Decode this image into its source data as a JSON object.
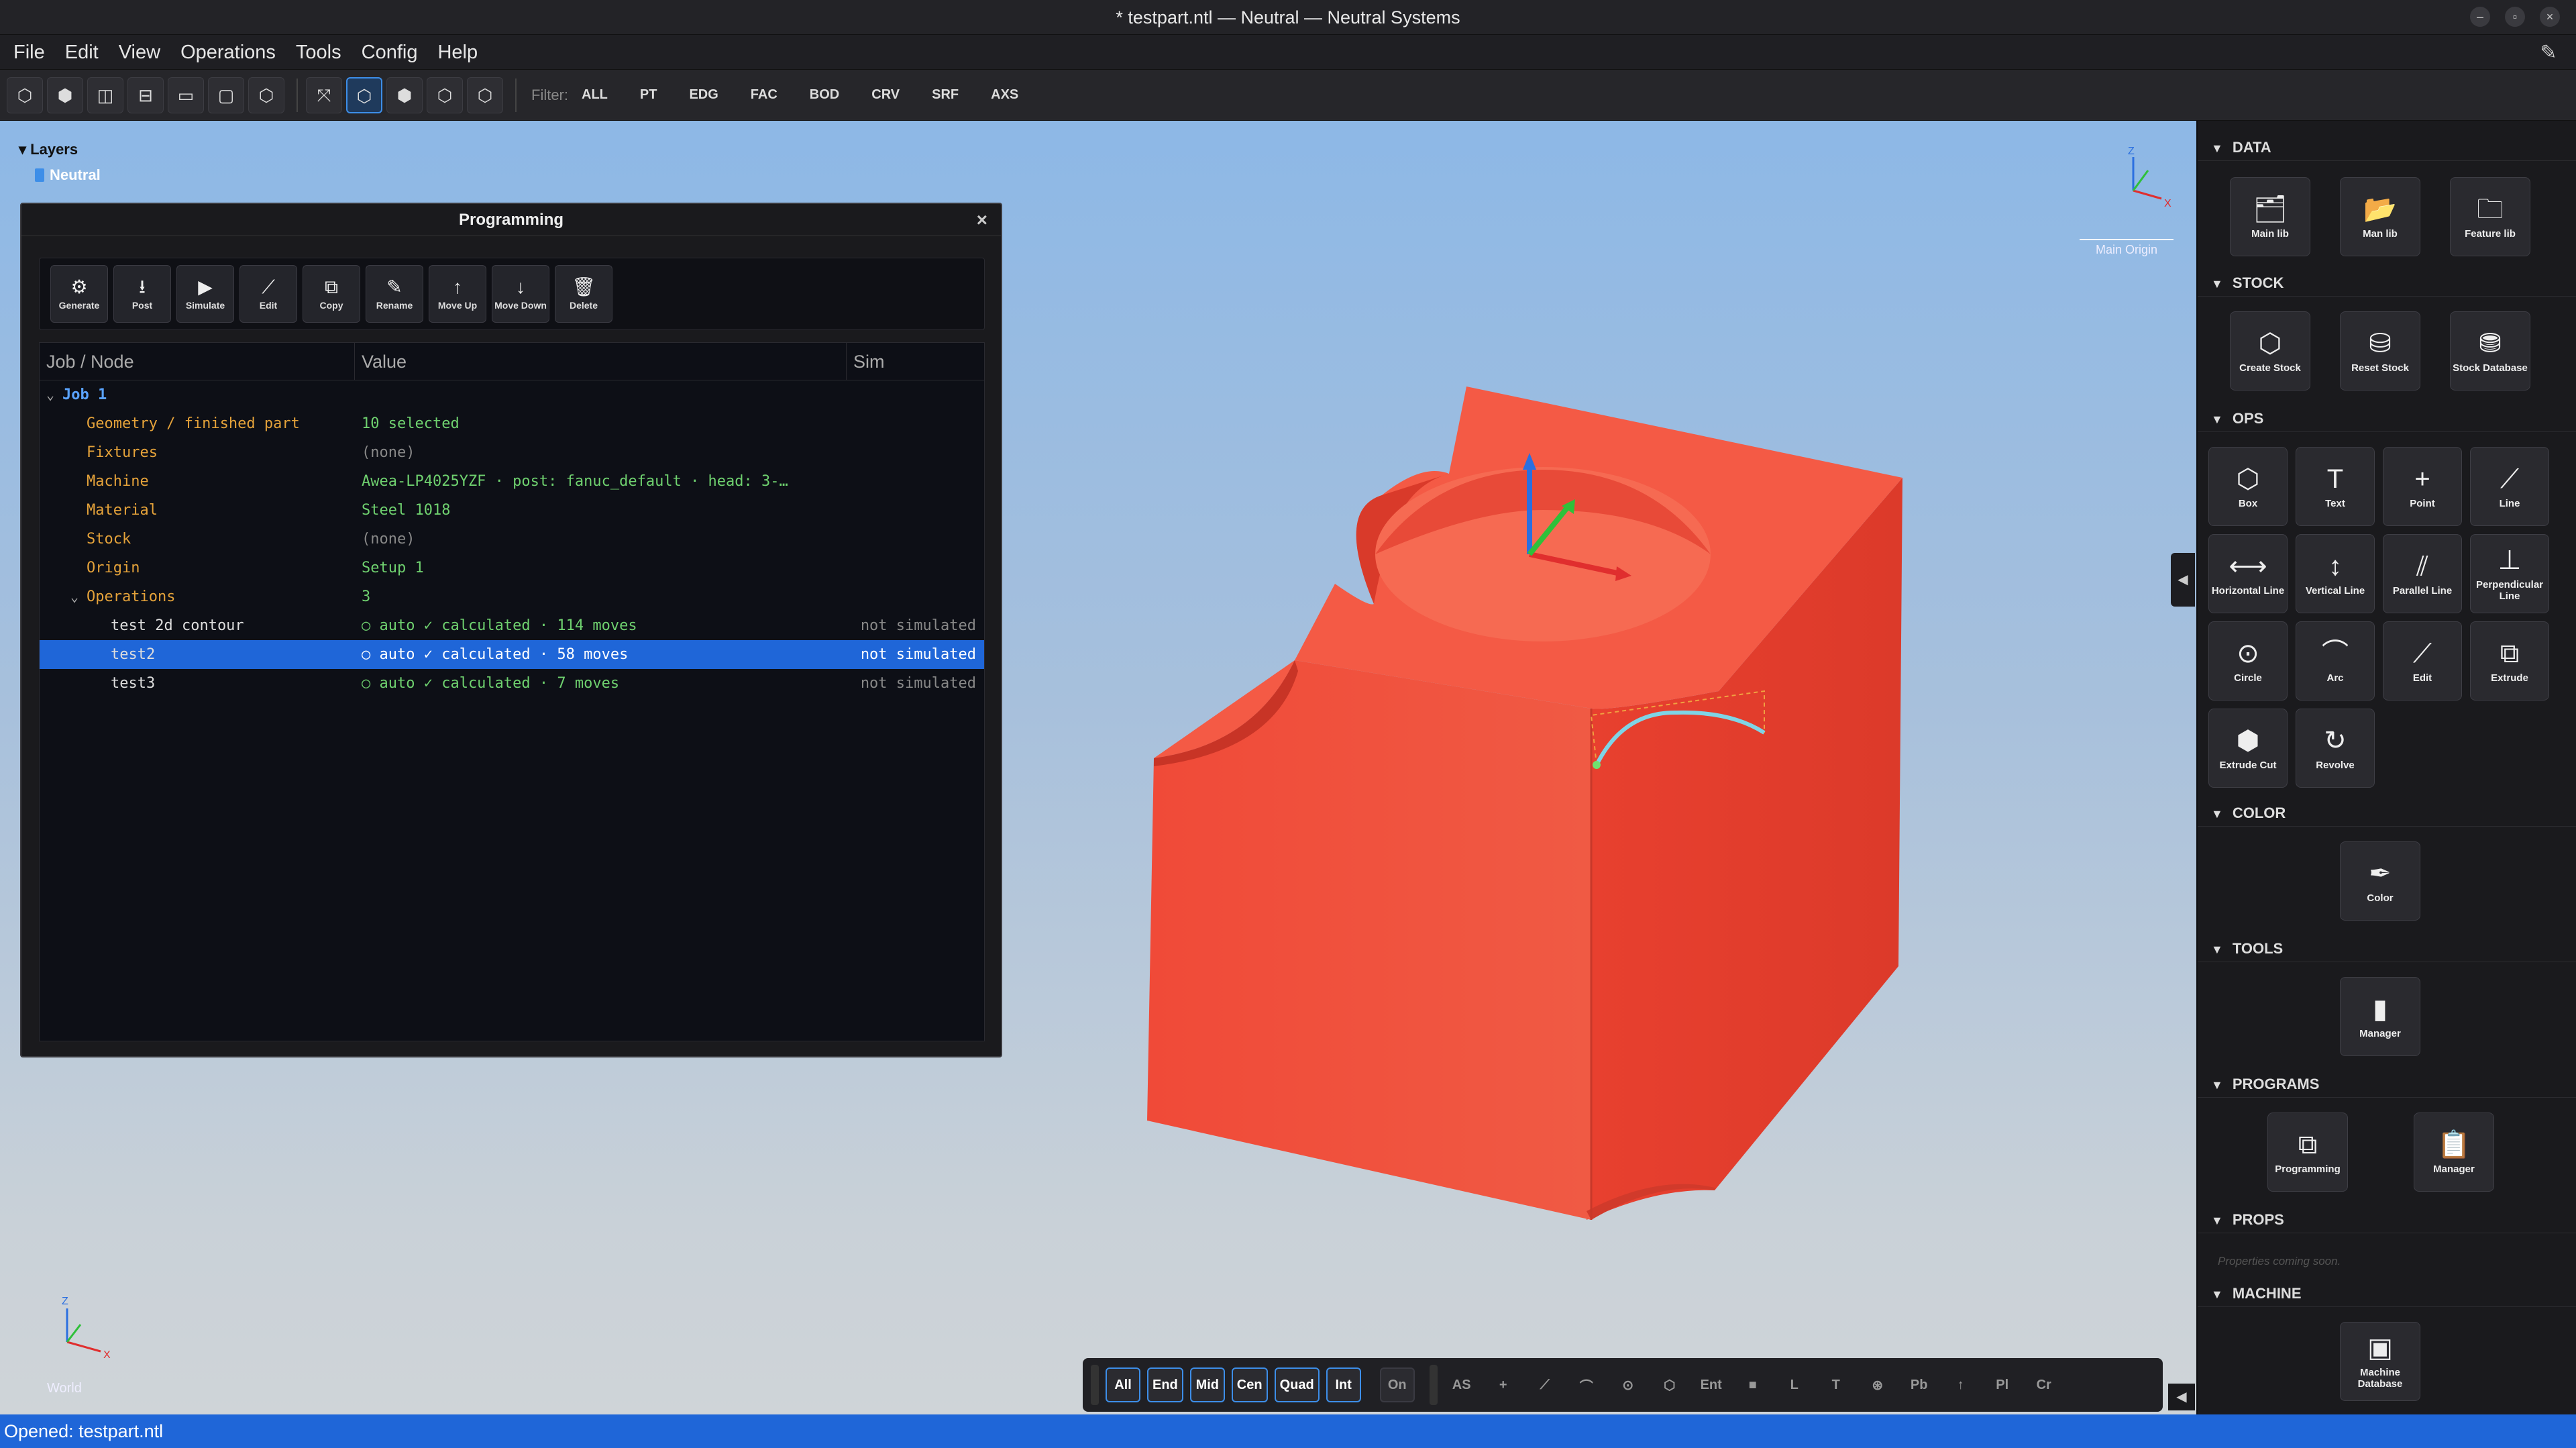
{
  "window": {
    "title": "* testpart.ntl — Neutral — Neutral Systems",
    "controls": [
      "–",
      "▫",
      "×"
    ]
  },
  "menubar": {
    "items": [
      "File",
      "Edit",
      "View",
      "Operations",
      "Tools",
      "Config",
      "Help"
    ]
  },
  "toolbar": {
    "view_icons": [
      "view-front-icon",
      "view-top-icon",
      "view-iso-icon",
      "view-left-icon",
      "view-back-icon",
      "view-bottom-icon",
      "view-right-icon",
      "fit-icon",
      "shaded-icon",
      "wire-icon",
      "hidden-icon",
      "edges-icon"
    ],
    "active_view_index": 8,
    "filter_label": "Filter:",
    "filters": [
      "ALL",
      "PT",
      "EDG",
      "FAC",
      "BOD",
      "CRV",
      "SRF",
      "AXS"
    ]
  },
  "layers": {
    "title": "Layers",
    "items": [
      "Neutral"
    ]
  },
  "viewport": {
    "main_origin": "Main Origin",
    "world": "World",
    "part_color": "#f0493a"
  },
  "programming": {
    "title": "Programming",
    "close": "×",
    "buttons": [
      {
        "icon": "gear-icon",
        "glyph": "⚙",
        "label": "Generate"
      },
      {
        "icon": "post-icon",
        "glyph": "⭳",
        "label": "Post"
      },
      {
        "icon": "play-icon",
        "glyph": "▶",
        "label": "Simulate"
      },
      {
        "icon": "edit-path-icon",
        "glyph": "⟋",
        "label": "Edit"
      },
      {
        "icon": "copy-icon",
        "glyph": "⧉",
        "label": "Copy"
      },
      {
        "icon": "rename-icon",
        "glyph": "✎",
        "label": "Rename"
      },
      {
        "icon": "arrow-up-icon",
        "glyph": "↑",
        "label": "Move Up"
      },
      {
        "icon": "arrow-down-icon",
        "glyph": "↓",
        "label": "Move Down"
      },
      {
        "icon": "trash-icon",
        "glyph": "🗑",
        "label": "Delete"
      }
    ],
    "columns": [
      "Job / Node",
      "Value",
      "Sim"
    ],
    "rows": [
      {
        "kind": "job",
        "indent": 0,
        "chev": "⌄",
        "node": "Job 1",
        "value": "",
        "sim": ""
      },
      {
        "kind": "prop",
        "indent": 1,
        "chev": "",
        "node": "Geometry / finished part",
        "value": "10 selected",
        "sim": ""
      },
      {
        "kind": "prop",
        "indent": 1,
        "chev": "",
        "node": "Fixtures",
        "value": "(none)",
        "sim": "",
        "none": true
      },
      {
        "kind": "prop",
        "indent": 1,
        "chev": "",
        "node": "Machine",
        "value": "Awea-LP4025YZF  ·  post: fanuc_default  ·  head: 3-…",
        "sim": ""
      },
      {
        "kind": "prop",
        "indent": 1,
        "chev": "",
        "node": "Material",
        "value": "Steel 1018",
        "sim": ""
      },
      {
        "kind": "prop",
        "indent": 1,
        "chev": "",
        "node": "Stock",
        "value": "(none)",
        "sim": "",
        "none": true
      },
      {
        "kind": "prop",
        "indent": 1,
        "chev": "",
        "node": "Origin",
        "value": "Setup 1",
        "sim": ""
      },
      {
        "kind": "prop",
        "indent": 1,
        "chev": "⌄",
        "node": "Operations",
        "value": "3",
        "sim": ""
      },
      {
        "kind": "op",
        "indent": 2,
        "chev": "",
        "node": "test 2d contour",
        "value": "○ auto   ✓ calculated · 114 moves",
        "sim": "not simulated"
      },
      {
        "kind": "op",
        "indent": 2,
        "chev": "",
        "node": "test2",
        "value": "○ auto   ✓ calculated · 58 moves",
        "sim": "not simulated",
        "selected": true
      },
      {
        "kind": "op",
        "indent": 2,
        "chev": "",
        "node": "test3",
        "value": "○ auto   ✓ calculated · 7 moves",
        "sim": "not simulated"
      }
    ]
  },
  "rightpanel": {
    "sections": [
      {
        "title": "DATA",
        "buttons": [
          {
            "icon": "main-lib-icon",
            "glyph": "🗂",
            "label": "Main lib"
          },
          {
            "icon": "man-lib-icon",
            "glyph": "📂",
            "label": "Man lib"
          },
          {
            "icon": "feature-lib-icon",
            "glyph": "🗀",
            "label": "Feature lib"
          }
        ]
      },
      {
        "title": "STOCK",
        "buttons": [
          {
            "icon": "create-stock-icon",
            "glyph": "⬡",
            "label": "Create Stock"
          },
          {
            "icon": "reset-stock-icon",
            "glyph": "⛁",
            "label": "Reset Stock"
          },
          {
            "icon": "stock-database-icon",
            "glyph": "⛃",
            "label": "Stock Database"
          }
        ]
      },
      {
        "title": "OPS",
        "buttons": [
          {
            "icon": "box-icon",
            "glyph": "⬡",
            "label": "Box"
          },
          {
            "icon": "text-icon",
            "glyph": "T",
            "label": "Text"
          },
          {
            "icon": "point-icon",
            "glyph": "+",
            "label": "Point"
          },
          {
            "icon": "line-icon",
            "glyph": "⟋",
            "label": "Line"
          },
          {
            "icon": "horizontal-line-icon",
            "glyph": "⟷",
            "label": "Horizontal Line"
          },
          {
            "icon": "vertical-line-icon",
            "glyph": "↕",
            "label": "Vertical Line"
          },
          {
            "icon": "parallel-line-icon",
            "glyph": "⫽",
            "label": "Parallel Line"
          },
          {
            "icon": "perpendicular-line-icon",
            "glyph": "⊥",
            "label": "Perpendicular Line"
          },
          {
            "icon": "circle-icon",
            "glyph": "⊙",
            "label": "Circle"
          },
          {
            "icon": "arc-icon",
            "glyph": "⌒",
            "label": "Arc"
          },
          {
            "icon": "edit-icon",
            "glyph": "⟋",
            "label": "Edit"
          },
          {
            "icon": "extrude-icon",
            "glyph": "⧉",
            "label": "Extrude"
          },
          {
            "icon": "extrude-cut-icon",
            "glyph": "⬢",
            "label": "Extrude Cut"
          },
          {
            "icon": "revolve-icon",
            "glyph": "↻",
            "label": "Revolve"
          }
        ]
      },
      {
        "title": "COLOR",
        "buttons": [
          {
            "icon": "color-icon",
            "glyph": "✒",
            "label": "Color"
          }
        ]
      },
      {
        "title": "TOOLS",
        "buttons": [
          {
            "icon": "tool-manager-icon",
            "glyph": "▮",
            "label": "Manager"
          }
        ]
      },
      {
        "title": "PROGRAMS",
        "buttons": [
          {
            "icon": "programming-icon",
            "glyph": "⧉",
            "label": "Programming"
          },
          {
            "icon": "program-manager-icon",
            "glyph": "📋",
            "label": "Manager"
          }
        ]
      },
      {
        "title": "PROPS",
        "placeholder": "Properties coming soon."
      },
      {
        "title": "MACHINE",
        "buttons": [
          {
            "icon": "machine-database-icon",
            "glyph": "▣",
            "label": "Machine Database"
          }
        ]
      }
    ]
  },
  "snapbar": {
    "group1": [
      {
        "label": "All",
        "on": true
      },
      {
        "label": "End",
        "on": true
      },
      {
        "label": "Mid",
        "on": true
      },
      {
        "label": "Cen",
        "on": true
      },
      {
        "label": "Quad",
        "on": true
      },
      {
        "label": "Int",
        "on": true
      }
    ],
    "toggle": "On",
    "group2": [
      {
        "label": "AS",
        "icon": "as-icon"
      },
      {
        "label": "+",
        "icon": "cross-icon"
      },
      {
        "label": "⟋",
        "icon": "line-snap-icon"
      },
      {
        "label": "⌒",
        "icon": "arc-snap-icon"
      },
      {
        "label": "⊙",
        "icon": "circle-snap-icon"
      },
      {
        "label": "⬡",
        "icon": "box-snap-icon"
      },
      {
        "label": "Ent",
        "icon": "ent-icon"
      },
      {
        "label": "■",
        "icon": "square-icon"
      },
      {
        "label": "L",
        "icon": "l-icon"
      },
      {
        "label": "T",
        "icon": "t-icon"
      },
      {
        "label": "⊛",
        "icon": "globe-icon"
      },
      {
        "label": "Pb",
        "icon": "pb-icon"
      },
      {
        "label": "↑",
        "icon": "up-icon"
      },
      {
        "label": "Pl",
        "icon": "pl-icon"
      },
      {
        "label": "Cr",
        "icon": "cr-icon"
      }
    ]
  },
  "statusbar": {
    "text": "Opened: testpart.ntl"
  }
}
